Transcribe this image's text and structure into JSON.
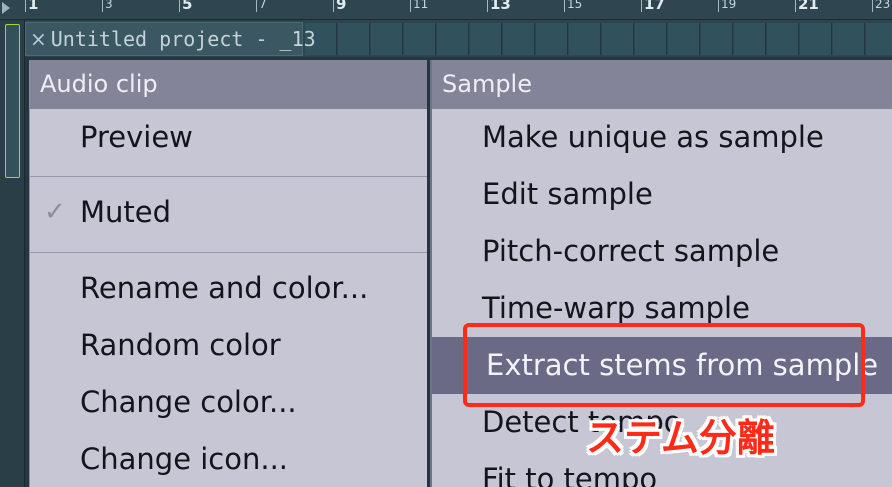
{
  "ruler": {
    "markers": [
      {
        "label": "1",
        "major": true
      },
      {
        "label": "3",
        "major": false
      },
      {
        "label": "5",
        "major": true
      },
      {
        "label": "7",
        "major": false
      },
      {
        "label": "9",
        "major": true
      },
      {
        "label": "11",
        "major": false
      },
      {
        "label": "13",
        "major": true
      },
      {
        "label": "15",
        "major": false
      },
      {
        "label": "17",
        "major": true
      },
      {
        "label": "19",
        "major": false
      },
      {
        "label": "21",
        "major": true
      },
      {
        "label": "23",
        "major": false
      }
    ]
  },
  "project_tab": {
    "close_icon": "×",
    "title": "Untitled project - _13"
  },
  "audio_clip_menu": {
    "header": "Audio clip",
    "check_icon": "✓",
    "items": [
      {
        "label": "Preview",
        "checked": false
      },
      {
        "label": "Muted",
        "checked": true
      },
      {
        "label": "Rename and color...",
        "checked": false
      },
      {
        "label": "Random color",
        "checked": false
      },
      {
        "label": "Change color...",
        "checked": false
      },
      {
        "label": "Change icon...",
        "checked": false
      }
    ]
  },
  "sample_menu": {
    "header": "Sample",
    "items": [
      {
        "label": "Make unique as sample",
        "highlighted": false
      },
      {
        "label": "Edit sample",
        "highlighted": false
      },
      {
        "label": "Pitch-correct sample",
        "highlighted": false
      },
      {
        "label": "Time-warp sample",
        "highlighted": false
      },
      {
        "label": "Extract stems from sample",
        "highlighted": true
      },
      {
        "label": "Detect tempo",
        "highlighted": false
      },
      {
        "label": "Fit to tempo",
        "highlighted": false
      }
    ]
  },
  "annotation": {
    "label": "ステム分離",
    "color": "#ff2a18"
  },
  "colors": {
    "menu_background": "#c6c6d4",
    "menu_header": "#848498",
    "menu_highlight": "#6a6a86",
    "scroll_handle_border": "#a4d43a"
  }
}
